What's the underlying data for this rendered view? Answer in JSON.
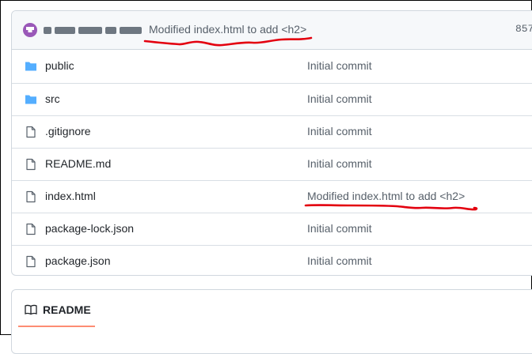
{
  "commit": {
    "author_text": "",
    "message": "Modified index.html to add <h2>",
    "hash": "857"
  },
  "files": [
    {
      "name": "public",
      "type": "folder",
      "message": "Initial commit"
    },
    {
      "name": "src",
      "type": "folder",
      "message": "Initial commit"
    },
    {
      "name": ".gitignore",
      "type": "file",
      "message": "Initial commit"
    },
    {
      "name": "README.md",
      "type": "file",
      "message": "Initial commit"
    },
    {
      "name": "index.html",
      "type": "file",
      "message": "Modified index.html to add <h2>"
    },
    {
      "name": "package-lock.json",
      "type": "file",
      "message": "Initial commit"
    },
    {
      "name": "package.json",
      "type": "file",
      "message": "Initial commit"
    }
  ],
  "readme": {
    "title": "README"
  },
  "colors": {
    "folder": "#54aeff",
    "file_icon": "#57606a",
    "annotation": "#e3000f",
    "tab_accent": "#fd8c73"
  }
}
